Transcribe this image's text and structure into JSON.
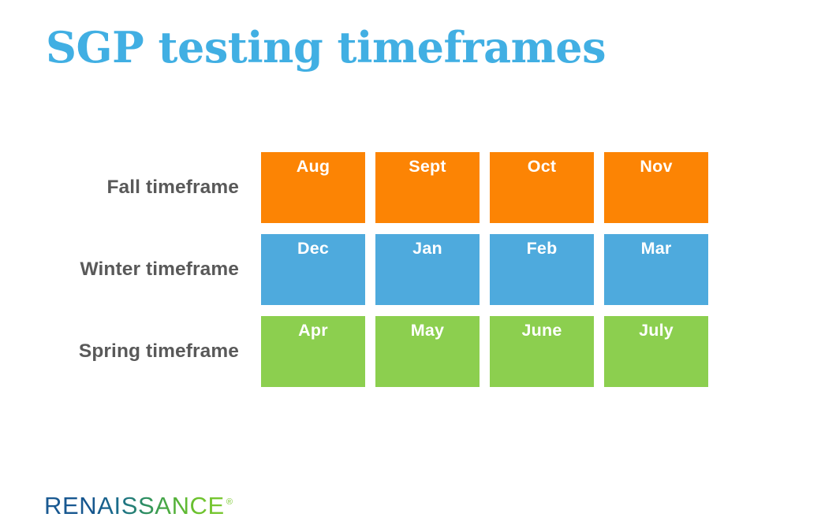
{
  "slide": {
    "title": "SGP testing timeframes",
    "title_color": "#41afe3",
    "background": "#ffffff"
  },
  "chart_data": {
    "type": "table",
    "title": "SGP testing timeframes",
    "row_label_header": "",
    "categories": [
      "Fall timeframe",
      "Winter timeframe",
      "Spring timeframe"
    ],
    "rows": [
      {
        "label": "Fall timeframe",
        "color": "#fc8404",
        "cells": [
          "Aug",
          "Sept",
          "Oct",
          "Nov"
        ]
      },
      {
        "label": "Winter timeframe",
        "color": "#4eaadd",
        "cells": [
          "Dec",
          "Jan",
          "Feb",
          "Mar"
        ]
      },
      {
        "label": "Spring timeframe",
        "color": "#8ccf4f",
        "cells": [
          "Apr",
          "May",
          "June",
          "July"
        ]
      }
    ],
    "legend": [],
    "grid": false
  },
  "logo": {
    "wordmark": "RENAISSANCE",
    "trademark": "®",
    "gradient_start": "#1a5a92",
    "gradient_end": "#7bc832"
  }
}
